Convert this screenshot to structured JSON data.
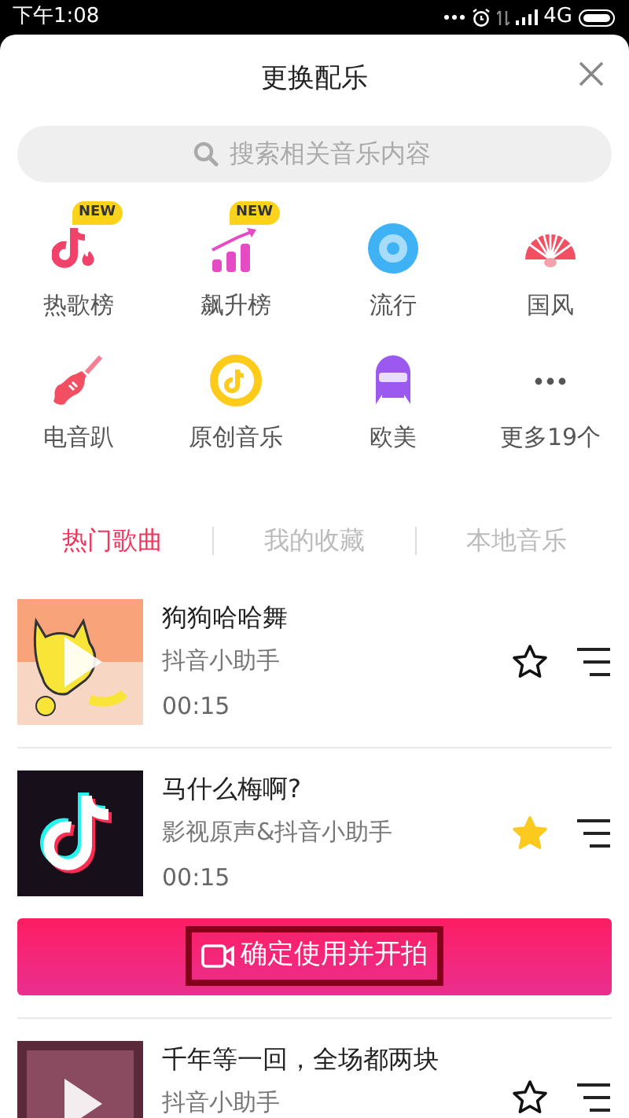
{
  "status_bar": {
    "time": "下午1:08",
    "network": "4G"
  },
  "sheet": {
    "title": "更换配乐",
    "search": {
      "placeholder": "搜索相关音乐内容"
    }
  },
  "categories": [
    {
      "label": "热歌榜",
      "badge": "NEW"
    },
    {
      "label": "飙升榜",
      "badge": "NEW"
    },
    {
      "label": "流行"
    },
    {
      "label": "国风"
    },
    {
      "label": "电音趴"
    },
    {
      "label": "原创音乐"
    },
    {
      "label": "欧美"
    },
    {
      "label": "更多19个"
    }
  ],
  "tabs": [
    {
      "label": "热门歌曲",
      "selected": true
    },
    {
      "label": "我的收藏",
      "selected": false
    },
    {
      "label": "本地音乐",
      "selected": false
    }
  ],
  "songs": [
    {
      "title": "狗狗哈哈舞",
      "artist": "抖音小助手",
      "duration": "00:15",
      "favorited": false
    },
    {
      "title": "马什么梅啊?",
      "artist": "影视原声&抖音小助手",
      "duration": "00:15",
      "favorited": true,
      "confirm_button": "确定使用并开拍"
    },
    {
      "title": "千年等一回，全场都两块",
      "artist": "抖音小助手"
    }
  ]
}
